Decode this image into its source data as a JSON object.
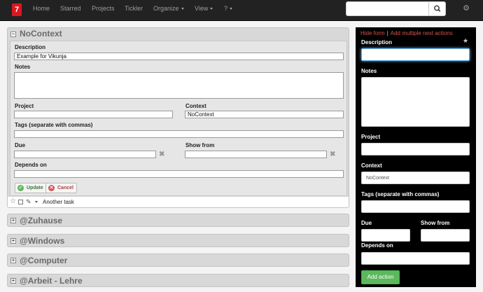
{
  "navbar": {
    "logo": "7",
    "items": [
      {
        "label": "Home"
      },
      {
        "label": "Starred"
      },
      {
        "label": "Projects"
      },
      {
        "label": "Tickler"
      },
      {
        "label": "Organize"
      },
      {
        "label": "View"
      },
      {
        "label": "?"
      }
    ],
    "search_value": ""
  },
  "contexts": [
    {
      "title": "NoContext"
    },
    {
      "title": "@Zuhause"
    },
    {
      "title": "@Windows"
    },
    {
      "title": "@Computer"
    },
    {
      "title": "@Arbeit - Lehre"
    }
  ],
  "edit_form": {
    "description_label": "Description",
    "description_value": "Example for Vikunja",
    "notes_label": "Notes",
    "notes_value": "",
    "project_label": "Project",
    "project_value": "",
    "context_label": "Context",
    "context_value": "NoContext",
    "tags_label": "Tags (separate with commas)",
    "tags_value": "",
    "due_label": "Due",
    "due_value": "",
    "show_from_label": "Show from",
    "show_from_value": "",
    "depends_label": "Depends on",
    "depends_value": "",
    "update_label": "Update",
    "cancel_label": "Cancel"
  },
  "task": {
    "name": "Another task"
  },
  "sidebar": {
    "hide_form": "Hide form",
    "separator": "|",
    "add_multiple": "Add multiple next actions",
    "description_label": "Description",
    "notes_label": "Notes",
    "project_label": "Project",
    "context_label": "Context",
    "context_value": "NoContext",
    "tags_label": "Tags (separate with commas)",
    "due_label": "Due",
    "show_from_label": "Show from",
    "depends_label": "Depends on",
    "add_label": "Add action"
  },
  "colors": {
    "navbar_bg": "#222222",
    "logo_red": "#d9181f",
    "link_red": "#d9534f",
    "add_green": "#5cb85c"
  }
}
